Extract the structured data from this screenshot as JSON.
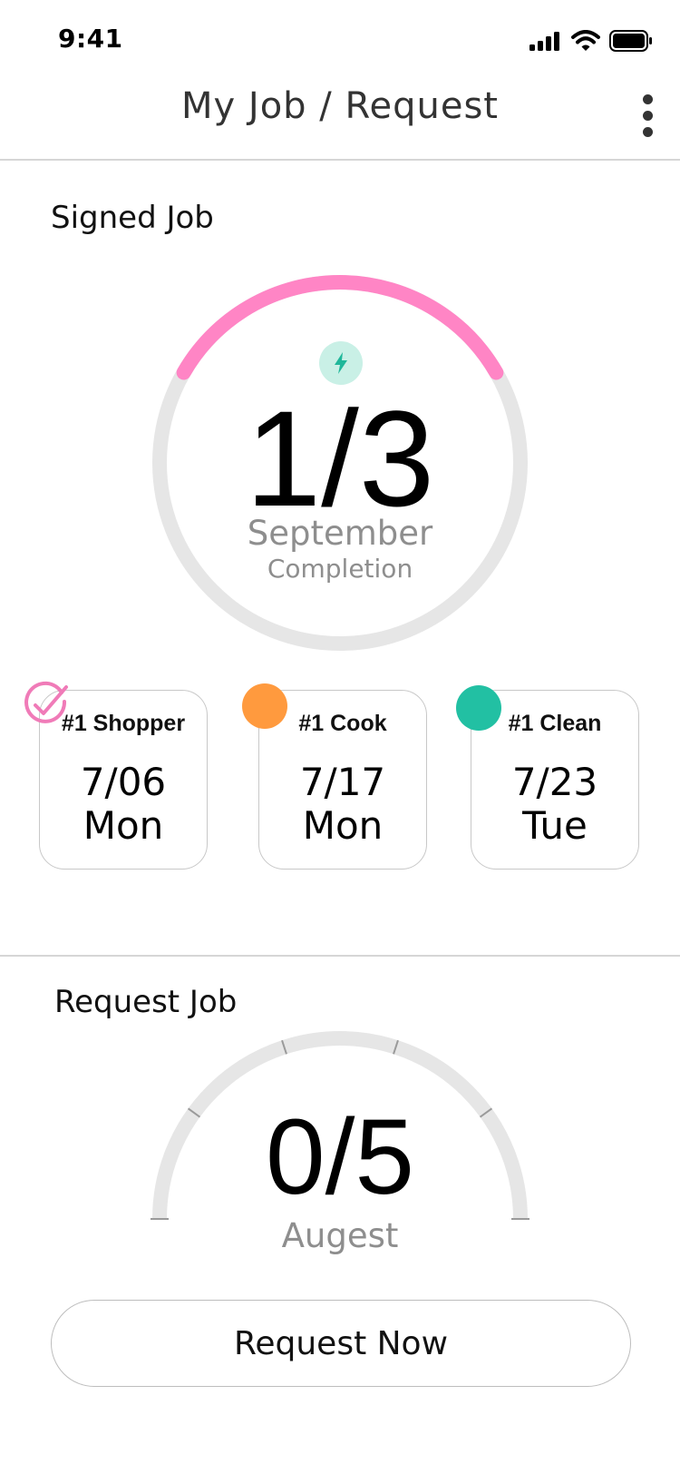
{
  "status_bar": {
    "time": "9:41"
  },
  "header": {
    "title": "My Job / Request"
  },
  "signed": {
    "title": "Signed Job",
    "value": "1/3",
    "month": "September",
    "caption": "Completion",
    "completed": 1,
    "total": 3,
    "accent_color": "#ff85c5",
    "icon": "lightning-icon"
  },
  "jobs": [
    {
      "role": "#1 Shopper",
      "date": "7/06",
      "day": "Mon",
      "status": "done",
      "color": "#f07bb8"
    },
    {
      "role": "#1 Cook",
      "date": "7/17",
      "day": "Mon",
      "status": "pending",
      "color": "#ff9a3e"
    },
    {
      "role": "#1 Clean",
      "date": "7/23",
      "day": "Tue",
      "status": "pending",
      "color": "#22c0a3"
    }
  ],
  "request": {
    "title": "Request Job",
    "value": "0/5",
    "month": "Augest",
    "current": 0,
    "total": 5,
    "button_label": "Request Now"
  }
}
